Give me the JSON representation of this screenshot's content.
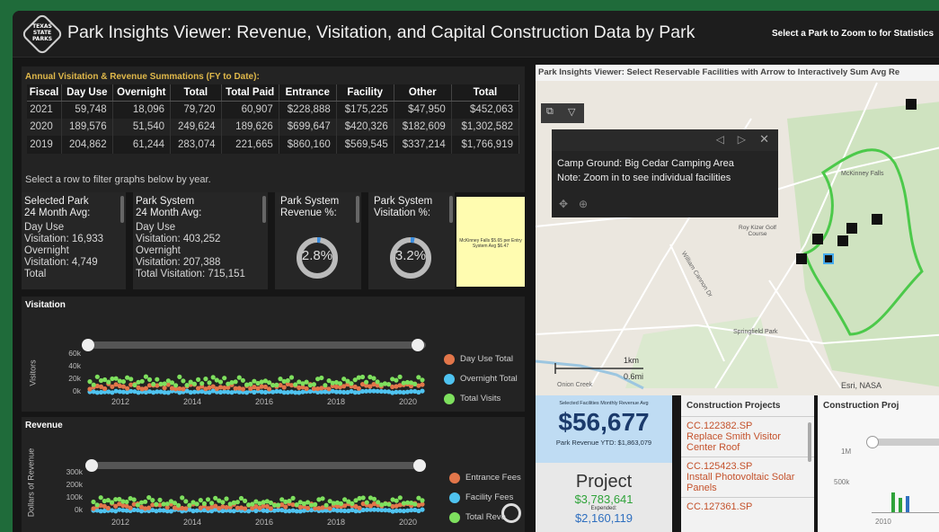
{
  "app": {
    "title": "Park Insights Viewer: Revenue, Visitation, and Capital Construction Data by Park",
    "zoom_hint": "Select a Park to Zoom to for Statistics",
    "logo_text": "TEXAS STATE PARKS"
  },
  "annual": {
    "title": "Annual Visitation & Revenue Summations (FY to Date):",
    "columns": [
      "Fiscal",
      "Day Use",
      "Overnight",
      "Total",
      "Total Paid",
      "Entrance",
      "Facility",
      "Other",
      "Total"
    ],
    "rows": [
      [
        "2021",
        "59,748",
        "18,096",
        "79,720",
        "60,907",
        "$228,888",
        "$175,225",
        "$47,950",
        "$452,063"
      ],
      [
        "2020",
        "189,576",
        "51,540",
        "249,624",
        "189,626",
        "$699,647",
        "$420,326",
        "$182,609",
        "$1,302,582"
      ],
      [
        "2019",
        "204,862",
        "61,244",
        "283,074",
        "221,665",
        "$860,160",
        "$569,545",
        "$337,214",
        "$1,766,919"
      ]
    ],
    "hint": "Select a row to filter graphs below by year."
  },
  "cards": {
    "selected": {
      "title": "Selected Park",
      "subtitle": "24 Month Avg:",
      "day_use": "Day Use",
      "day_use_val": "Visitation: 16,933",
      "overnight": "Overnight",
      "overnight_val": "Visitation: 4,749",
      "total": "Total"
    },
    "system": {
      "title": "Park System",
      "subtitle": "24 Month Avg:",
      "day_use": "Day Use",
      "day_use_val": "Visitation: 403,252",
      "overnight": "Overnight",
      "overnight_val": "Visitation: 207,388",
      "total": "Total Visitation: 715,151"
    },
    "rev_pct": {
      "title": "Park System",
      "subtitle": "Revenue %:",
      "value": "2.8%",
      "fraction": 0.028
    },
    "vis_pct": {
      "title": "Park System",
      "subtitle": "Visitation %:",
      "value": "3.2%",
      "fraction": 0.032
    },
    "sticky": "McKinney Falls $5.65 per Entry System Avg $6.47"
  },
  "visitation": {
    "title": "Visitation",
    "ylabel": "Visitors",
    "yticks": [
      "60k",
      "40k",
      "20k",
      "0k"
    ],
    "xticks": [
      "2012",
      "2014",
      "2016",
      "2018",
      "2020"
    ],
    "legend": [
      {
        "label": "Day Use Total",
        "color": "#e2764a"
      },
      {
        "label": "Overnight Total",
        "color": "#4fc3f0"
      },
      {
        "label": "Total Visits",
        "color": "#7ee05e"
      }
    ]
  },
  "revenue": {
    "title": "Revenue",
    "ylabel": "Dollars of Revenue",
    "yticks": [
      "300k",
      "200k",
      "100k",
      "0k"
    ],
    "xticks": [
      "2012",
      "2014",
      "2016",
      "2018",
      "2020"
    ],
    "legend": [
      {
        "label": "Entrance Fees",
        "color": "#e2764a"
      },
      {
        "label": "Facility Fees",
        "color": "#4fc3f0"
      },
      {
        "label": "Total Reve",
        "color": "#7ee05e"
      }
    ]
  },
  "map": {
    "title": "Park Insights Viewer: Select Reservable Facilities with Arrow to Interactively Sum Avg Re",
    "popup_line1": "Camp Ground: Big Cedar Camping Area",
    "popup_line2": "Note: Zoom in to see individual facilities",
    "labels": [
      "McKinney Falls",
      "Roy Kizer Golf Course",
      "Springfield Park",
      "Onion Creek",
      "William Cannon Dr",
      "Esri, NASA"
    ],
    "scale_km": "1km",
    "scale_mi": "0.6mi"
  },
  "kpi": {
    "small": "Selected Facilities Monthly Revenue Avg",
    "value": "$56,677",
    "ytd": "Park Revenue YTD: $1,863,079"
  },
  "project": {
    "title": "Project",
    "value": "$3,783,641",
    "expended_label": "Expended:",
    "expended": "$2,160,119"
  },
  "construction": {
    "title": "Construction Projects",
    "items": [
      {
        "id": "CC.122382.SP",
        "name": "Replace Smith Visitor Center Roof"
      },
      {
        "id": "CC.125423.SP",
        "name": "Install Photovoltaic Solar Panels"
      },
      {
        "id": "CC.127361.SP",
        "name": ""
      }
    ],
    "chart_title": "Construction Proj",
    "chart_yticks": [
      "1M",
      "500k"
    ],
    "chart_xtick": "2010"
  }
}
